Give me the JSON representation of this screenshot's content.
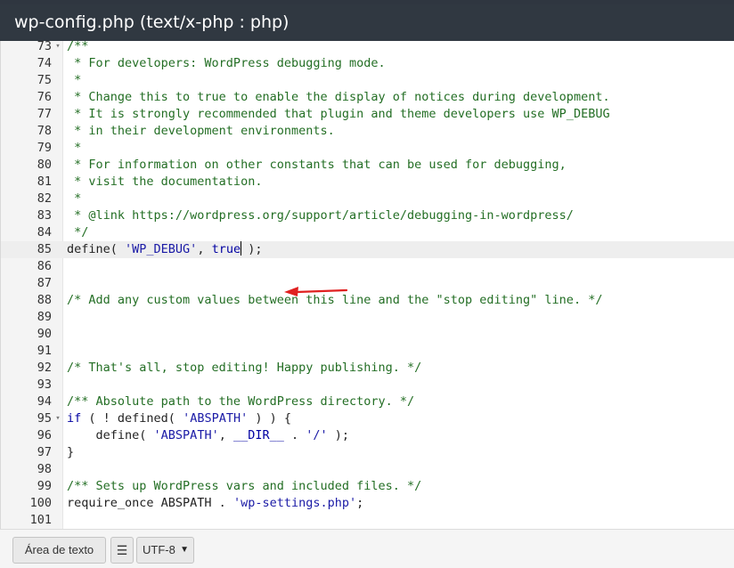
{
  "window": {
    "title": "wp-config.php (text/x-php : php)"
  },
  "editor": {
    "active_line": 85,
    "lines": [
      {
        "n": "73",
        "fold": true,
        "tokens": [
          {
            "t": "c",
            "v": "/**"
          }
        ]
      },
      {
        "n": "74",
        "tokens": [
          {
            "t": "c",
            "v": " * For developers: WordPress debugging mode."
          }
        ]
      },
      {
        "n": "75",
        "tokens": [
          {
            "t": "c",
            "v": " *"
          }
        ]
      },
      {
        "n": "76",
        "tokens": [
          {
            "t": "c",
            "v": " * Change this to true to enable the display of notices during development."
          }
        ]
      },
      {
        "n": "77",
        "tokens": [
          {
            "t": "c",
            "v": " * It is strongly recommended that plugin and theme developers use WP_DEBUG"
          }
        ]
      },
      {
        "n": "78",
        "tokens": [
          {
            "t": "c",
            "v": " * in their development environments."
          }
        ]
      },
      {
        "n": "79",
        "tokens": [
          {
            "t": "c",
            "v": " *"
          }
        ]
      },
      {
        "n": "80",
        "tokens": [
          {
            "t": "c",
            "v": " * For information on other constants that can be used for debugging,"
          }
        ]
      },
      {
        "n": "81",
        "tokens": [
          {
            "t": "c",
            "v": " * visit the documentation."
          }
        ]
      },
      {
        "n": "82",
        "tokens": [
          {
            "t": "c",
            "v": " *"
          }
        ]
      },
      {
        "n": "83",
        "tokens": [
          {
            "t": "c",
            "v": " * @link https://wordpress.org/support/article/debugging-in-wordpress/"
          }
        ]
      },
      {
        "n": "84",
        "tokens": [
          {
            "t": "c",
            "v": " */"
          }
        ]
      },
      {
        "n": "85",
        "tokens": [
          {
            "t": "p",
            "v": "define( "
          },
          {
            "t": "s",
            "v": "'WP_DEBUG'"
          },
          {
            "t": "p",
            "v": ", "
          },
          {
            "t": "k",
            "v": "true"
          },
          {
            "t": "cursor",
            "v": ""
          },
          {
            "t": "p",
            "v": " );"
          }
        ]
      },
      {
        "n": "86",
        "tokens": []
      },
      {
        "n": "87",
        "tokens": []
      },
      {
        "n": "88",
        "tokens": [
          {
            "t": "c",
            "v": "/* Add any custom values between this line and the \"stop editing\" line. */"
          }
        ]
      },
      {
        "n": "89",
        "tokens": []
      },
      {
        "n": "90",
        "tokens": []
      },
      {
        "n": "91",
        "tokens": []
      },
      {
        "n": "92",
        "tokens": [
          {
            "t": "c",
            "v": "/* That's all, stop editing! Happy publishing. */"
          }
        ]
      },
      {
        "n": "93",
        "tokens": []
      },
      {
        "n": "94",
        "tokens": [
          {
            "t": "c",
            "v": "/** Absolute path to the WordPress directory. */"
          }
        ]
      },
      {
        "n": "95",
        "fold": true,
        "tokens": [
          {
            "t": "k",
            "v": "if"
          },
          {
            "t": "p",
            "v": " ( ! defined( "
          },
          {
            "t": "s",
            "v": "'ABSPATH'"
          },
          {
            "t": "p",
            "v": " ) ) {"
          }
        ]
      },
      {
        "n": "96",
        "tokens": [
          {
            "t": "p",
            "v": "    define( "
          },
          {
            "t": "s",
            "v": "'ABSPATH'"
          },
          {
            "t": "p",
            "v": ", "
          },
          {
            "t": "k",
            "v": "__DIR__"
          },
          {
            "t": "p",
            "v": " . "
          },
          {
            "t": "s",
            "v": "'/'"
          },
          {
            "t": "p",
            "v": " );"
          }
        ]
      },
      {
        "n": "97",
        "tokens": [
          {
            "t": "p",
            "v": "}"
          }
        ]
      },
      {
        "n": "98",
        "tokens": []
      },
      {
        "n": "99",
        "tokens": [
          {
            "t": "c",
            "v": "/** Sets up WordPress vars and included files. */"
          }
        ]
      },
      {
        "n": "100",
        "tokens": [
          {
            "t": "p",
            "v": "require_once ABSPATH . "
          },
          {
            "t": "s",
            "v": "'wp-settings.php'"
          },
          {
            "t": "p",
            "v": ";"
          }
        ]
      },
      {
        "n": "101",
        "tokens": []
      }
    ]
  },
  "footer": {
    "textarea_button": "Área de texto",
    "settings_icon": "sliders-icon",
    "encoding_selected": "UTF-8"
  },
  "colors": {
    "titlebar": "#303841",
    "comment": "#236e24",
    "string": "#1a1aa6",
    "keyword": "#0000a2",
    "arrow": "#e02020"
  }
}
